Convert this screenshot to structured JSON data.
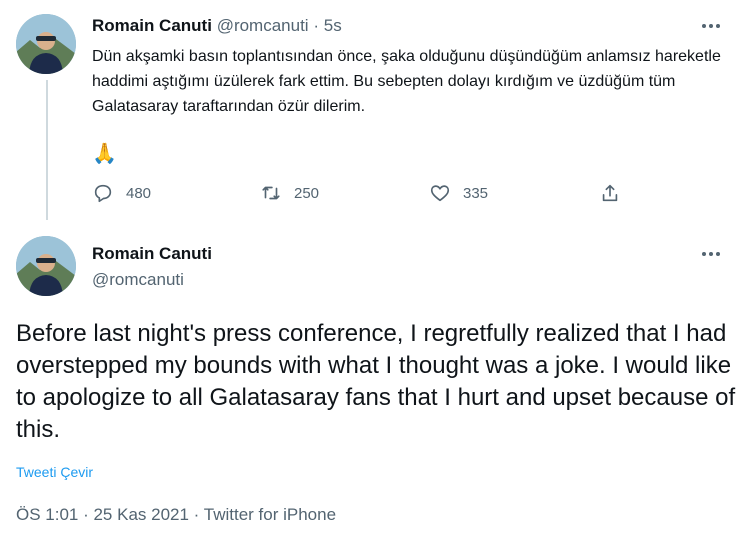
{
  "tweet1": {
    "author_name": "Romain Canuti",
    "author_handle": "@romcanuti",
    "separator": "·",
    "time": "5s",
    "text": "Dün akşamki basın toplantısından önce, şaka olduğunu düşündüğüm anlamsız hareketle haddimi aştığımı üzülerek fark ettim. Bu sebepten dolayı kırdığım ve üzdüğüm tüm Galatasaray taraftarından özür dilerim.",
    "emoji": "🙏",
    "replies": "480",
    "retweets": "250",
    "likes": "335"
  },
  "tweet2": {
    "author_name": "Romain Canuti",
    "author_handle": "@romcanuti",
    "text": "Before last night's press conference, I regretfully realized that I had overstepped my bounds with what I thought was a joke. I would like to apologize to all Galatasaray fans that I hurt and upset because of this.",
    "translate_label": "Tweeti Çevir",
    "meta": "ÖS 1:01 · 25 Kas 2021 · Twitter for iPhone"
  },
  "icons": {
    "reply": "reply-icon",
    "retweet": "retweet-icon",
    "like": "heart-icon",
    "share": "share-icon",
    "more": "more-icon"
  },
  "colors": {
    "text": "#0f1419",
    "secondary": "#536471",
    "link": "#1d9bf0",
    "thread_line": "#cfd9de"
  }
}
